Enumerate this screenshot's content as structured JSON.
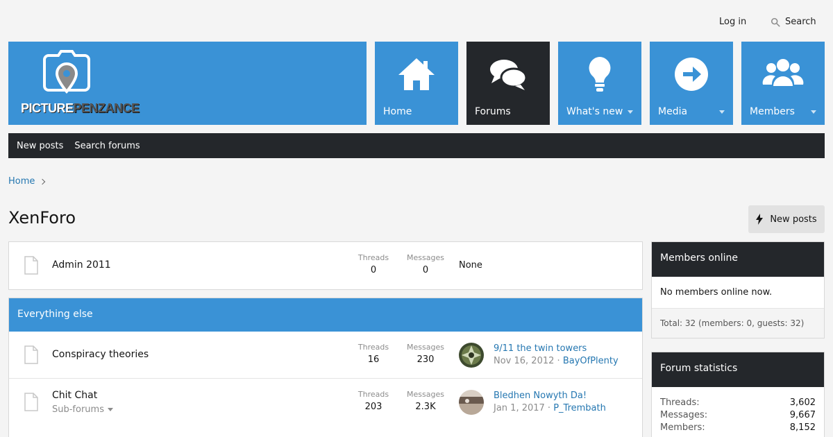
{
  "header": {
    "login_label": "Log in",
    "search_label": "Search",
    "logo": {
      "word1": "PICTURE",
      "word2": "PENZANCE"
    }
  },
  "nav": {
    "tiles": [
      {
        "label": "Home",
        "icon": "home-icon",
        "active": false,
        "dropdown": false
      },
      {
        "label": "Forums",
        "icon": "chat-bubbles-icon",
        "active": true,
        "dropdown": false
      },
      {
        "label": "What's new",
        "icon": "lightbulb-icon",
        "active": false,
        "dropdown": true
      },
      {
        "label": "Media",
        "icon": "arrow-circle-icon",
        "active": false,
        "dropdown": true
      },
      {
        "label": "Members",
        "icon": "users-icon",
        "active": false,
        "dropdown": true
      }
    ],
    "subnav": [
      "New posts",
      "Search forums"
    ]
  },
  "breadcrumb": {
    "home": "Home"
  },
  "page": {
    "title": "XenForo",
    "new_posts_button": "New posts"
  },
  "forums": {
    "threads_label": "Threads",
    "messages_label": "Messages",
    "top_forum": {
      "name": "Admin 2011",
      "threads": "0",
      "messages": "0",
      "last": "None"
    },
    "category": {
      "title": "Everything else",
      "rows": [
        {
          "name": "Conspiracy theories",
          "threads": "16",
          "messages": "230",
          "last_title": "9/11 the twin towers",
          "last_date": "Nov 16, 2012",
          "last_user": "BayOfPlenty"
        },
        {
          "name": "Chit Chat",
          "sub": "Sub-forums",
          "threads": "203",
          "messages": "2.3K",
          "last_title": "Bledhen Nowyth Da!",
          "last_date": "Jan 1, 2017",
          "last_user": "P_Trembath"
        }
      ]
    }
  },
  "sidebar": {
    "members_online": {
      "title": "Members online",
      "body": "No members online now.",
      "total": "Total: 32 (members: 0, guests: 32)"
    },
    "forum_stats": {
      "title": "Forum statistics",
      "rows": [
        {
          "label": "Threads:",
          "value": "3,602"
        },
        {
          "label": "Messages:",
          "value": "9,667"
        },
        {
          "label": "Members:",
          "value": "8,152"
        }
      ]
    }
  },
  "colors": {
    "accent": "#3a92d6",
    "dark": "#24272b",
    "link": "#2577b1"
  }
}
